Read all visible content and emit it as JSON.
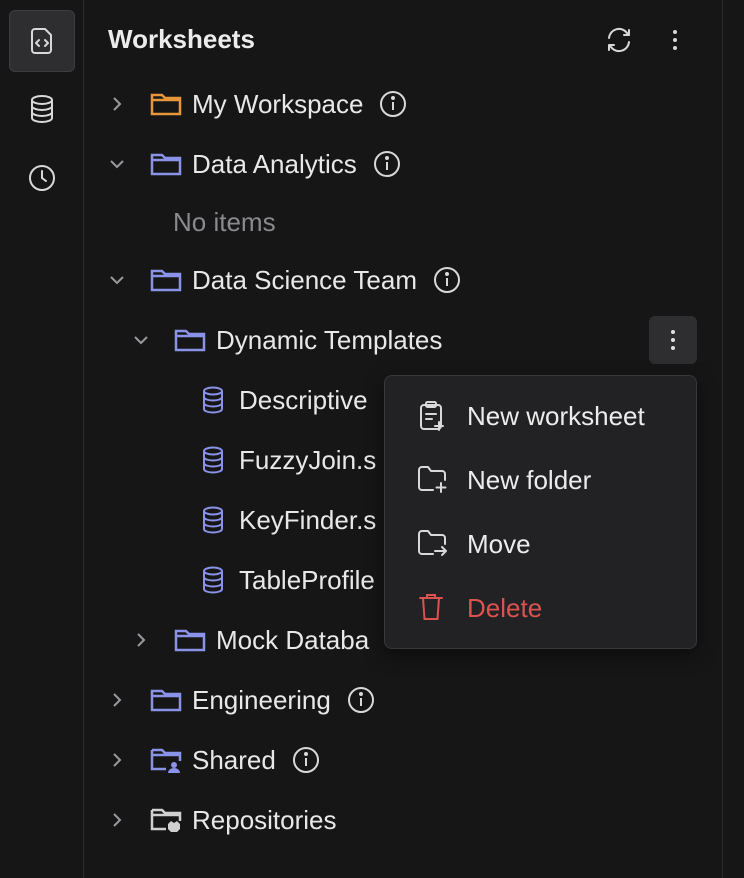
{
  "rail": {
    "items": [
      {
        "icon": "worksheets-icon"
      },
      {
        "icon": "database-icon"
      },
      {
        "icon": "history-icon"
      }
    ]
  },
  "header": {
    "title": "Worksheets",
    "refresh_icon": "refresh-icon",
    "more_icon": "kebab-icon"
  },
  "tree": {
    "my_workspace": "My Workspace",
    "data_analytics": "Data Analytics",
    "no_items": "No items",
    "data_science_team": "Data Science Team",
    "dynamic_templates": "Dynamic Templates",
    "files": [
      "Descriptive",
      "FuzzyJoin.s",
      "KeyFinder.s",
      "TableProfile"
    ],
    "mock_database": "Mock Databa",
    "engineering": "Engineering",
    "shared": "Shared",
    "repositories": "Repositories"
  },
  "context_menu": {
    "new_worksheet": "New worksheet",
    "new_folder": "New folder",
    "move": "Move",
    "delete": "Delete"
  },
  "colors": {
    "folder_orange": "#e8963a",
    "folder_blue": "#8a93e8",
    "danger": "#d9534f",
    "background": "#161617"
  }
}
